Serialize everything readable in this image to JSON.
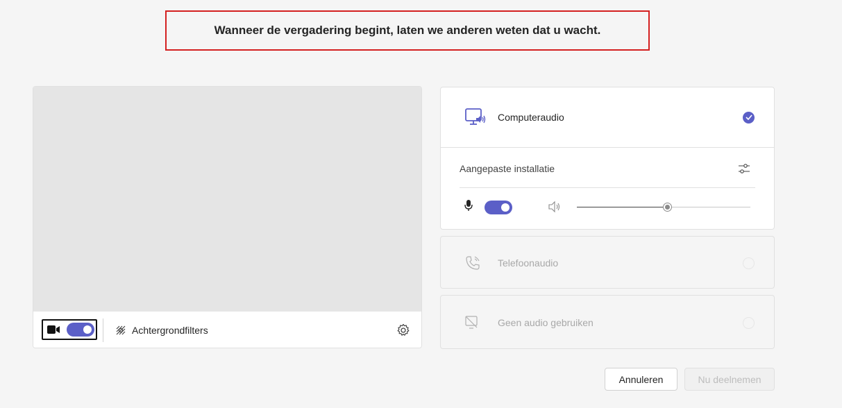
{
  "banner": {
    "text": "Wanneer de vergadering begint, laten we anderen weten dat u wacht."
  },
  "preview": {
    "camera_icon": "camera-icon",
    "camera_on": true,
    "background_filters_label": "Achtergrondfilters",
    "background_filters_icon": "background-effects-icon",
    "settings_icon": "gear-icon"
  },
  "audio": {
    "computer": {
      "label": "Computeraudio",
      "icon": "computer-speaker-icon",
      "selected": true
    },
    "custom_setup": {
      "title": "Aangepaste installatie",
      "settings_icon": "sliders-icon",
      "mic_on": true,
      "volume_percent": 52
    },
    "phone": {
      "label": "Telefoonaudio",
      "icon": "phone-icon",
      "selected": false
    },
    "none": {
      "label": "Geen audio gebruiken",
      "icon": "no-audio-icon",
      "selected": false
    }
  },
  "buttons": {
    "cancel": "Annuleren",
    "join": "Nu deelnemen"
  },
  "colors": {
    "accent": "#5b5fc7",
    "highlight_border": "#d42020",
    "disabled_text": "#a8a8a8"
  }
}
